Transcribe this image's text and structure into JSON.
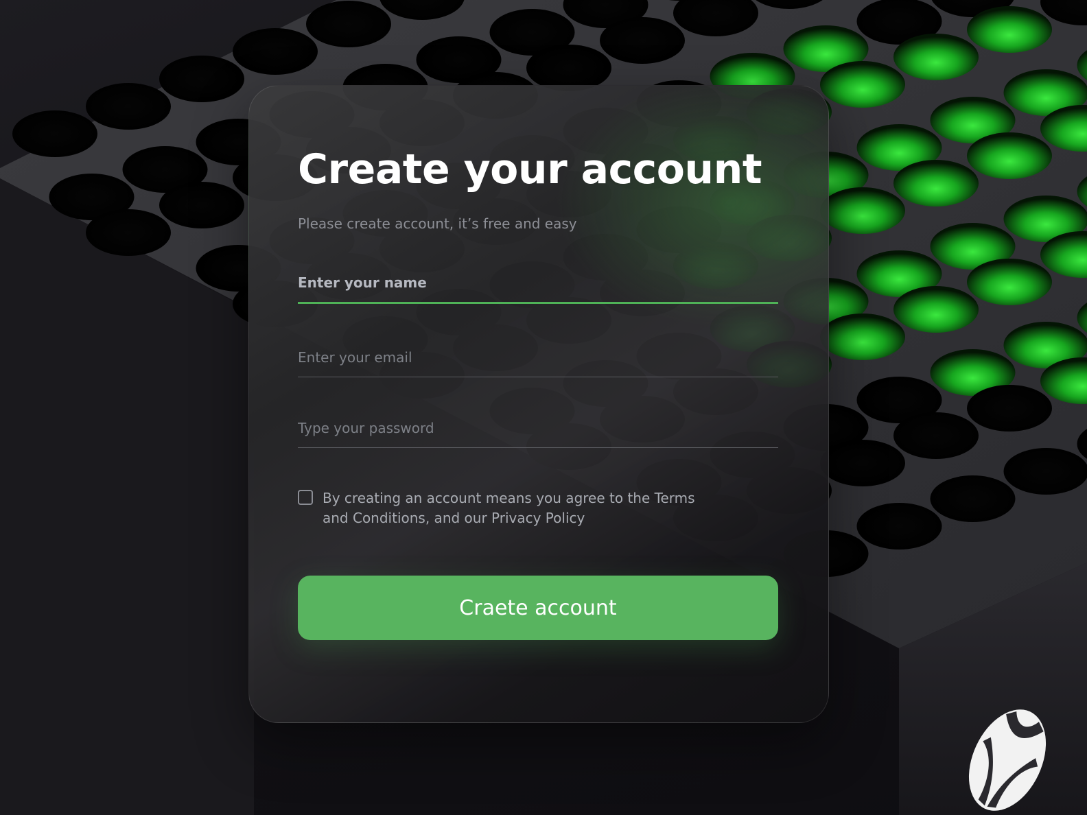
{
  "signup_card": {
    "title": "Create your account",
    "subtitle": "Please create account, it’s free and easy",
    "fields": {
      "name_placeholder": "Enter your name",
      "email_placeholder": "Enter your email",
      "password_placeholder": "Type your password"
    },
    "terms_text": "By creating an account means you agree to the Terms and Conditions, and our Privacy Policy",
    "terms_checked": false,
    "submit_label": "Craete account"
  },
  "colors": {
    "accent": "#58b45f",
    "focus_line": "#4fb257",
    "background": "#131216"
  },
  "background_image": {
    "subject": "xbox-console-vent-grille",
    "logo": "xbox-logo-icon"
  }
}
